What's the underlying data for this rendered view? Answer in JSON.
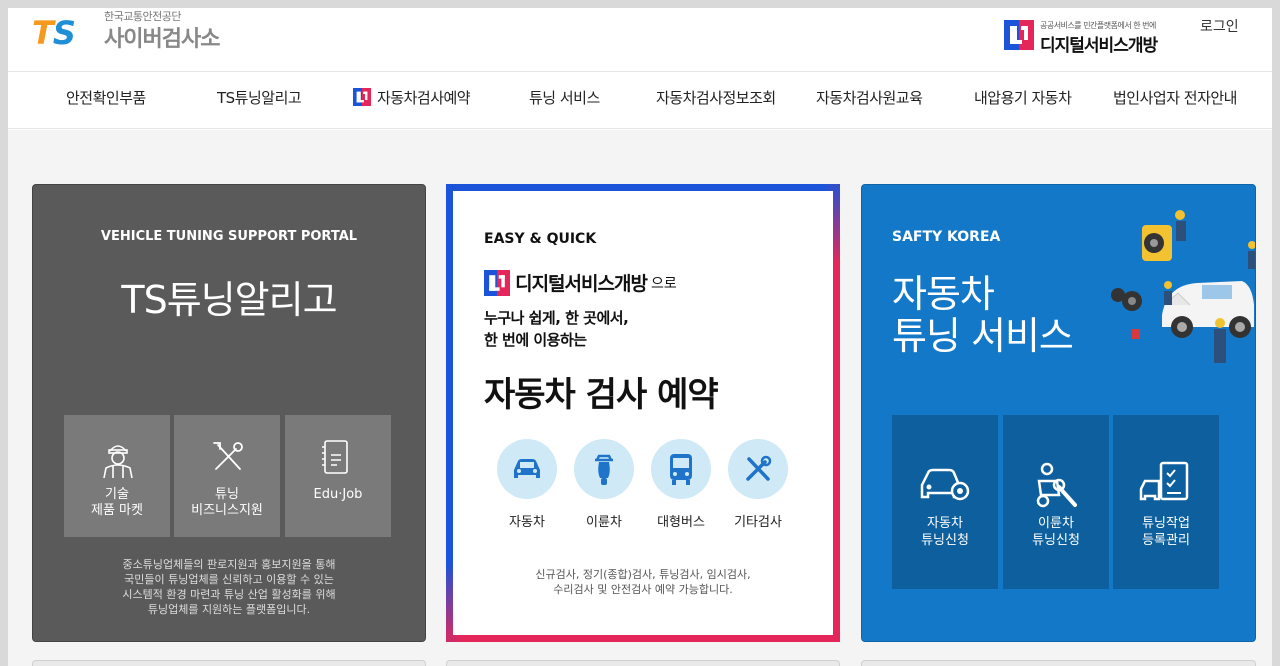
{
  "header": {
    "brand_logo": "TS",
    "brand_sub": "한국교통안전공단",
    "brand_main": "사이버검사소",
    "digital_small": "공공서비스를 민간플랫폼에서 한 번에",
    "digital_big": "디지털서비스개방",
    "login_label": "로그인"
  },
  "nav": {
    "items": [
      "안전확인부품",
      "TS튜닝알리고",
      "자동차검사예약",
      "튜닝 서비스",
      "자동차검사정보조회",
      "자동차검사원교육",
      "내압용기 자동차",
      "법인사업자 전자안내"
    ]
  },
  "card_tuning_portal": {
    "caption": "VEHICLE TUNING SUPPORT PORTAL",
    "title": "TS튜닝알리고",
    "tiles": [
      {
        "line1": "기술",
        "line2": "제품 마켓",
        "icon": "mechanic-icon"
      },
      {
        "line1": "튜닝",
        "line2": "비즈니스지원",
        "icon": "tools-icon"
      },
      {
        "line1": "Edu·Job",
        "line2": "",
        "icon": "document-icon"
      }
    ],
    "desc": [
      "중소튜닝업체들의 판로지원과 홍보지원을 통해",
      "국민들이 튜닝업체를 신뢰하고 이용할 수 있는",
      "시스템적 환경 마련과 튜닝 산업 활성화를 위해",
      "튜닝업체를 지원하는 플랫폼입니다."
    ]
  },
  "card_inspection": {
    "caption": "EASY & QUICK",
    "logo_name": "디지털서비스개방",
    "logo_suffix": "으로",
    "line1": "누구나 쉽게, 한 곳에서,",
    "line2": "한 번에 이용하는",
    "title": "자동차 검사 예약",
    "services": [
      {
        "label": "자동차",
        "icon": "car-icon"
      },
      {
        "label": "이륜차",
        "icon": "scooter-icon"
      },
      {
        "label": "대형버스",
        "icon": "bus-icon"
      },
      {
        "label": "기타검사",
        "icon": "tools-icon"
      }
    ],
    "desc": [
      "신규검사, 정기(종합)검사, 튜닝검사, 임시검사,",
      "수리검사 및 안전검사 예약 가능합니다."
    ]
  },
  "card_tuning_service": {
    "caption": "SAFTY KOREA",
    "title_line1": "자동차",
    "title_line2": "튜닝 서비스",
    "tiles": [
      {
        "line1": "자동차",
        "line2": "튜닝신청",
        "icon": "car-gear-icon"
      },
      {
        "line1": "이륜차",
        "line2": "튜닝신청",
        "icon": "scooter-wrench-icon"
      },
      {
        "line1": "튜닝작업",
        "line2": "등록관리",
        "icon": "checklist-car-icon"
      }
    ]
  },
  "colors": {
    "gray_card": "#5a5a5a",
    "blue_card": "#1478c8",
    "ds_blue": "#1b54d9",
    "ds_red": "#e5265a",
    "service_circle": "#cfe9f6"
  }
}
